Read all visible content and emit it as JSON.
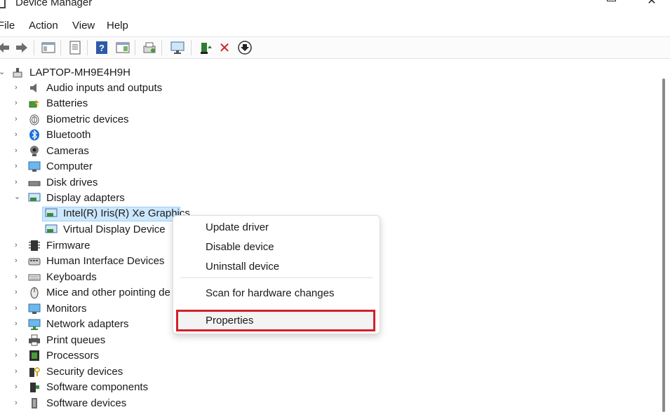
{
  "window": {
    "title": "Device Manager",
    "controls": [
      "minimize",
      "maximize",
      "close"
    ],
    "close_glyph": "✕"
  },
  "menu": [
    "File",
    "Action",
    "View",
    "Help"
  ],
  "toolbar": {
    "buttons": [
      "back-icon",
      "forward-icon",
      "show-hide-console-tree-icon",
      "properties-icon",
      "help-icon",
      "action-pane-icon",
      "scan-hardware-icon",
      "computer-monitor-icon",
      "update-driver-icon",
      "uninstall-device-icon",
      "disable-device-icon"
    ],
    "uninstall_glyph": "✕",
    "disable_glyph": "⬇",
    "accent_red": "#d32029"
  },
  "tree": {
    "root": "LAPTOP-MH9E4H9H",
    "categories": [
      {
        "label": "Audio inputs and outputs",
        "icon": "speaker-icon",
        "expanded": false
      },
      {
        "label": "Batteries",
        "icon": "battery-icon",
        "expanded": false
      },
      {
        "label": "Biometric devices",
        "icon": "fingerprint-icon",
        "expanded": false
      },
      {
        "label": "Bluetooth",
        "icon": "bluetooth-icon",
        "expanded": false
      },
      {
        "label": "Cameras",
        "icon": "camera-icon",
        "expanded": false
      },
      {
        "label": "Computer",
        "icon": "computer-icon",
        "expanded": false
      },
      {
        "label": "Disk drives",
        "icon": "disk-drive-icon",
        "expanded": false
      },
      {
        "label": "Display adapters",
        "icon": "display-adapter-icon",
        "expanded": true,
        "children": [
          {
            "label": "Intel(R) Iris(R) Xe Graphics",
            "selected": true
          },
          {
            "label": "Virtual Display Device",
            "selected": false
          }
        ]
      },
      {
        "label": "Firmware",
        "icon": "firmware-icon",
        "expanded": false
      },
      {
        "label": "Human Interface Devices",
        "icon": "hid-icon",
        "expanded": false
      },
      {
        "label": "Keyboards",
        "icon": "keyboard-icon",
        "expanded": false
      },
      {
        "label": "Mice and other pointing de",
        "icon": "mouse-icon",
        "expanded": false
      },
      {
        "label": "Monitors",
        "icon": "monitor-icon",
        "expanded": false
      },
      {
        "label": "Network adapters",
        "icon": "network-adapter-icon",
        "expanded": false
      },
      {
        "label": "Print queues",
        "icon": "printer-icon",
        "expanded": false
      },
      {
        "label": "Processors",
        "icon": "processor-icon",
        "expanded": false
      },
      {
        "label": "Security devices",
        "icon": "security-device-icon",
        "expanded": false
      },
      {
        "label": "Software components",
        "icon": "software-component-icon",
        "expanded": false
      },
      {
        "label": "Software devices",
        "icon": "software-device-icon",
        "expanded": false
      }
    ]
  },
  "context_menu": {
    "items": [
      "Update driver",
      "Disable device",
      "Uninstall device",
      "Scan for hardware changes",
      "Properties"
    ],
    "highlighted": "Properties",
    "highlight_color": "#d32029"
  }
}
